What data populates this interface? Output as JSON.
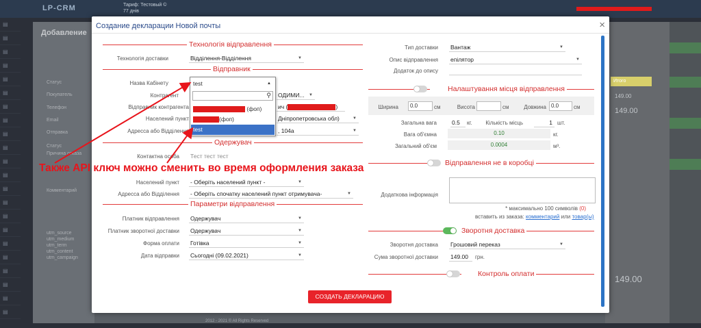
{
  "background": {
    "logo": "LP-CRM",
    "tariff_line1": "Тариф: Тестовый ©",
    "tariff_line2": "77 днів",
    "bg_title": "Добавление",
    "bg_labels": [
      "Статус",
      "Покупатель",
      "Телефон",
      "Email",
      "Отправка",
      "Статус",
      "Причина отказа",
      "Комментарий"
    ],
    "utm_labels": [
      "utm_source",
      "utm_medium",
      "utm_term",
      "utm_content",
      "utm_campaign"
    ],
    "right_header": "Итого",
    "right_values": [
      "149.00",
      "149.00",
      "149.00"
    ],
    "footer_text": "2012 - 2021 © All Rights Reserved"
  },
  "modal": {
    "title": "Создание декларации Новой почты",
    "close_label": "×",
    "left": {
      "sec_tech": "Технологія відправлення",
      "tech_label": "Технологія доставки",
      "tech_value": "Відділення-Відділення",
      "sec_sender": "Відправник",
      "cabinet_label": "Назва Кабінету",
      "kontragent_label": "Контрагент",
      "kontragent_value_tail": "ОДИМИ...",
      "sender_contact_label": "Відправник контрагента",
      "sender_contact_tail": "ич (",
      "city_label": "Населений пункт",
      "city_tail": "Дніпропетровська обл)",
      "addr_label": "Адресса або Відділення",
      "addr_tail": ", 104а",
      "sec_receiver": "Одержувач",
      "contact_label": "Контактна особа",
      "contact_value": "Тест тест тест",
      "phone_value_mask": "",
      "r_city_label": "Населений пункт",
      "r_city_value": "- Оберіть населений пункт -",
      "r_addr_label": "Адресса або Відділення",
      "r_addr_value": "- Оберіть спочатку населений пункт отримувача-",
      "sec_params": "Параметри відправлення",
      "payer_label": "Платник відправлення",
      "payer_value": "Одержувач",
      "return_payer_label": "Платник зворотної доставки",
      "return_payer_value": "Одержувач",
      "payment_label": "Форма оплати",
      "payment_value": "Готівка",
      "date_label": "Дата відправки",
      "date_value": "Сьогодні (09.02.2021)"
    },
    "right": {
      "delivery_type_label": "Тип доставки",
      "delivery_type_value": "Вантаж",
      "desc_label": "Опис відправлення",
      "desc_value": "епілятор",
      "addition_label": "Додаток до опису",
      "sec_place": "Налаштування місця відправлення",
      "width_label": "Ширина",
      "width_value": "0.0",
      "height_label": "Висота",
      "height_value": "",
      "length_label": "Довжина",
      "length_value": "0.0",
      "unit_cm": "см",
      "weight_label": "Загальна вага",
      "weight_value": "0.5",
      "unit_kg": "кг.",
      "places_label": "Кількість місць",
      "places_value": "1",
      "unit_pcs": "шт.",
      "vol_weight_label": "Вага об'ємна",
      "vol_weight_value": "0.10",
      "unit_kg2": "кг.",
      "vol_label": "Загальний об'єм",
      "vol_value": "0.0004",
      "unit_m3": "м³.",
      "sec_nobox": "Відправлення не в коробці",
      "extra_label": "Додаткова інформація",
      "extra_value": "",
      "max_note_prefix": "* максимально 100 символів",
      "max_note_count": "(0)",
      "insert_prefix": "вставить из заказа:",
      "insert_comment": "комментарий",
      "insert_or": "или",
      "insert_goods": "товар(ы)",
      "sec_return": "Зворотня доставка",
      "return_label": "Зворотня доставка",
      "return_value": "Грошовий переказ",
      "return_sum_label": "Сума зворотної доставки",
      "return_sum_value": "149.00",
      "unit_uah": "грн.",
      "sec_control": "Контроль оплати"
    },
    "submit_label": "СОЗДАТЬ ДЕКЛАРАЦИЮ"
  },
  "dropdown": {
    "selected": "test",
    "search_placeholder": "",
    "options": [
      {
        "suffix": "(фоп)"
      },
      {
        "suffix": "(фоп)"
      },
      {
        "label": "test"
      }
    ]
  },
  "annotation": "Также API ключ можно сменить во время оформления заказа",
  "colors": {
    "accent_red": "#e8232a",
    "highlight": "#3b72c7",
    "title_blue": "#2a4a8a"
  }
}
